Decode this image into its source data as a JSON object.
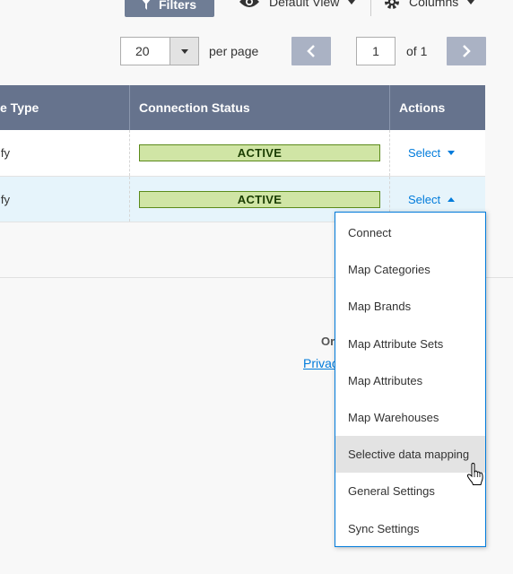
{
  "toolbar": {
    "filters_label": "Filters",
    "view_label": "Default View",
    "columns_label": "Columns"
  },
  "pager": {
    "per_page_value": "20",
    "per_page_label": "per page",
    "current_page": "1",
    "of_label": "of 1"
  },
  "grid": {
    "headers": {
      "type": "e Type",
      "status": "Connection Status",
      "actions": "Actions"
    },
    "rows": [
      {
        "type": "ify",
        "status": "ACTIVE",
        "action": "Select"
      },
      {
        "type": "ify",
        "status": "ACTIVE",
        "action": "Select"
      }
    ]
  },
  "footer": {
    "or_text": "Or",
    "link_text": "Privac"
  },
  "dropdown": {
    "items": [
      "Connect",
      "Map Categories",
      "Map Brands",
      "Map Attribute Sets",
      "Map Attributes",
      "Map Warehouses",
      "Selective data mapping",
      "General Settings",
      "Sync Settings"
    ]
  },
  "colors": {
    "header_bg": "#66738d",
    "active_badge_bg": "#d0e5a5",
    "link_blue": "#007bdb",
    "selected_row_bg": "#e6f4fb"
  }
}
